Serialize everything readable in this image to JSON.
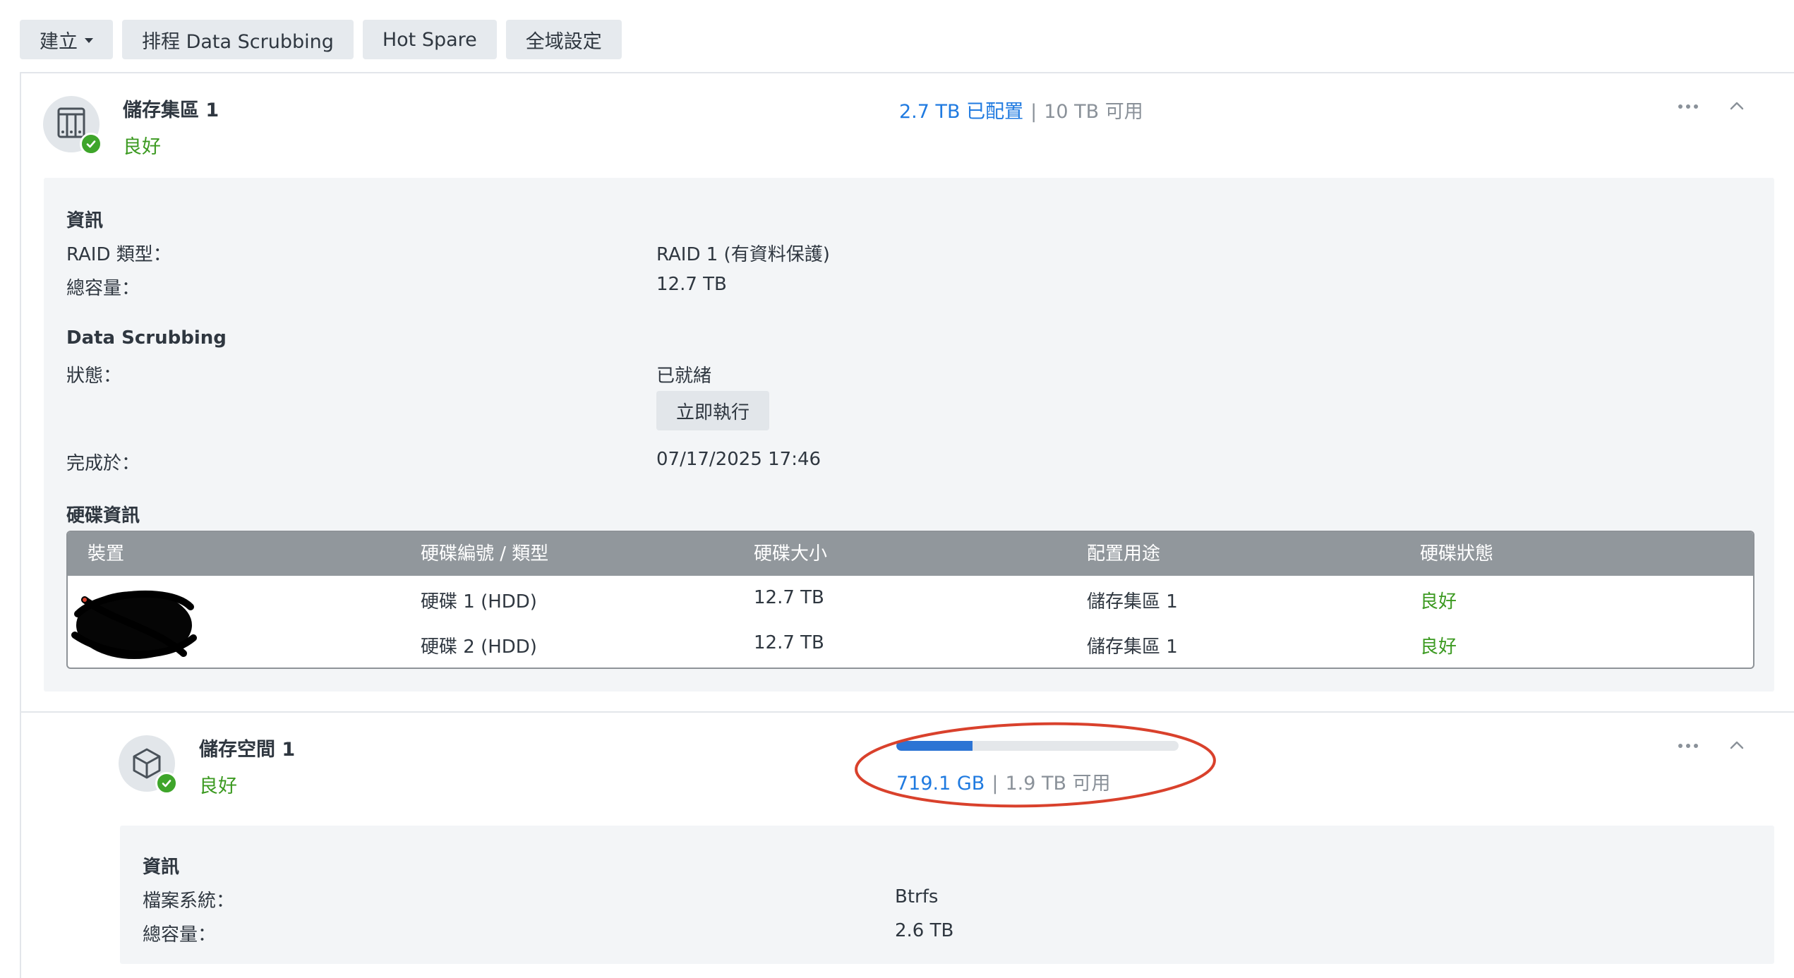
{
  "toolbar": {
    "create_label": "建立",
    "scrub_label": "排程 Data Scrubbing",
    "hotspare_label": "Hot Spare",
    "global_label": "全域設定"
  },
  "pool": {
    "name": "儲存集區 1",
    "status": "良好",
    "allocated": "2.7 TB 已配置",
    "available": "10 TB 可用",
    "info_heading": "資訊",
    "raid_label": "RAID 類型：",
    "raid_value": "RAID 1 (有資料保護)",
    "capacity_label": "總容量：",
    "capacity_value": "12.7 TB",
    "scrub_heading": "Data Scrubbing",
    "state_label": "狀態：",
    "state_value": "已就緒",
    "run_now_label": "立即執行",
    "completed_label": "完成於：",
    "completed_value": "07/17/2025 17:46",
    "disk_heading": "硬碟資訊",
    "disk_table": {
      "headers": [
        "裝置",
        "硬碟編號 / 類型",
        "硬碟大小",
        "配置用途",
        "硬碟狀態"
      ],
      "rows": [
        {
          "id": "硬碟 1 (HDD)",
          "size": "12.7 TB",
          "usage": "儲存集區 1",
          "status": "良好"
        },
        {
          "id": "硬碟 2 (HDD)",
          "size": "12.7 TB",
          "usage": "儲存集區 1",
          "status": "良好"
        }
      ]
    }
  },
  "volume": {
    "name": "儲存空間 1",
    "status": "良好",
    "used": "719.1 GB",
    "available": "1.9 TB 可用",
    "usage_fraction": 0.27,
    "info_heading": "資訊",
    "fs_label": "檔案系統：",
    "fs_value": "Btrfs",
    "capacity_label": "總容量：",
    "capacity_value": "2.6 TB"
  },
  "icons": {
    "pool_icon": "nas-drive-icon",
    "volume_icon": "cube-icon",
    "status_icon": "check-icon",
    "menu_icon": "more-dots-icon",
    "collapse_icon": "chevron-up-icon"
  },
  "colors": {
    "good": "#3c9a21",
    "link_blue": "#1f7ae0",
    "progress_fill": "#2c74d4",
    "annotation_red": "#d9412c"
  }
}
